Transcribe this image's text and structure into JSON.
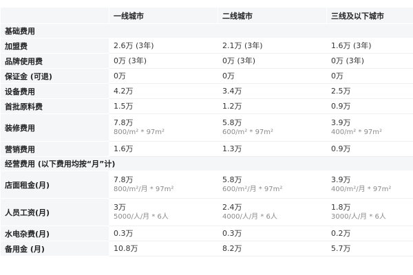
{
  "headers": [
    "",
    "一线城市",
    "二线城市",
    "三线及以下城市"
  ],
  "sections": [
    {
      "title": "基础费用",
      "rows": [
        {
          "label": "加盟费",
          "cells": [
            {
              "main": "2.6万 (3年)"
            },
            {
              "main": "2.1万 (3年)"
            },
            {
              "main": "1.6万 (3年)"
            }
          ]
        },
        {
          "label": "品牌使用费",
          "cells": [
            {
              "main": "0万 (3年)"
            },
            {
              "main": "0万 (3年)"
            },
            {
              "main": "0万 (3年)"
            }
          ]
        },
        {
          "label": "保证金 (可退)",
          "cells": [
            {
              "main": "0万"
            },
            {
              "main": "0万"
            },
            {
              "main": "0万"
            }
          ]
        },
        {
          "label": "设备费用",
          "cells": [
            {
              "main": "4.2万"
            },
            {
              "main": "3.4万"
            },
            {
              "main": "2.5万"
            }
          ]
        },
        {
          "label": "首批原料费",
          "cells": [
            {
              "main": "1.5万"
            },
            {
              "main": "1.2万"
            },
            {
              "main": "0.9万"
            }
          ]
        },
        {
          "label": "装修费用",
          "cells": [
            {
              "main": "7.8万",
              "sub": "800/m² * 97m²"
            },
            {
              "main": "5.8万",
              "sub": "600/m² * 97m²"
            },
            {
              "main": "3.9万",
              "sub": "400/m² * 97m²"
            }
          ]
        },
        {
          "label": "营销费用",
          "cells": [
            {
              "main": "1.6万"
            },
            {
              "main": "1.3万"
            },
            {
              "main": "0.9万"
            }
          ]
        }
      ]
    },
    {
      "title": "经营费用 (以下费用均按“月”计)",
      "rows": [
        {
          "label": "店面租金(月)",
          "cells": [
            {
              "main": "7.8万",
              "sub": "800/m²/月 * 97m²"
            },
            {
              "main": "5.8万",
              "sub": "600/m²/月 * 97m²"
            },
            {
              "main": "3.9万",
              "sub": "400/m²/月 * 97m²"
            }
          ]
        },
        {
          "label": "人员工资(月)",
          "cells": [
            {
              "main": "3万",
              "sub": "5000/人/月 * 6人"
            },
            {
              "main": "2.4万",
              "sub": "4000/人/月 * 6人"
            },
            {
              "main": "1.8万",
              "sub": "3000/人/月 * 6人"
            }
          ]
        },
        {
          "label": "水电杂费(月)",
          "cells": [
            {
              "main": "0.3万"
            },
            {
              "main": "0.3万"
            },
            {
              "main": "0.2万"
            }
          ]
        },
        {
          "label": "备用金 (月)",
          "cells": [
            {
              "main": "10.8万"
            },
            {
              "main": "8.2万"
            },
            {
              "main": "5.7万"
            }
          ]
        }
      ]
    }
  ]
}
